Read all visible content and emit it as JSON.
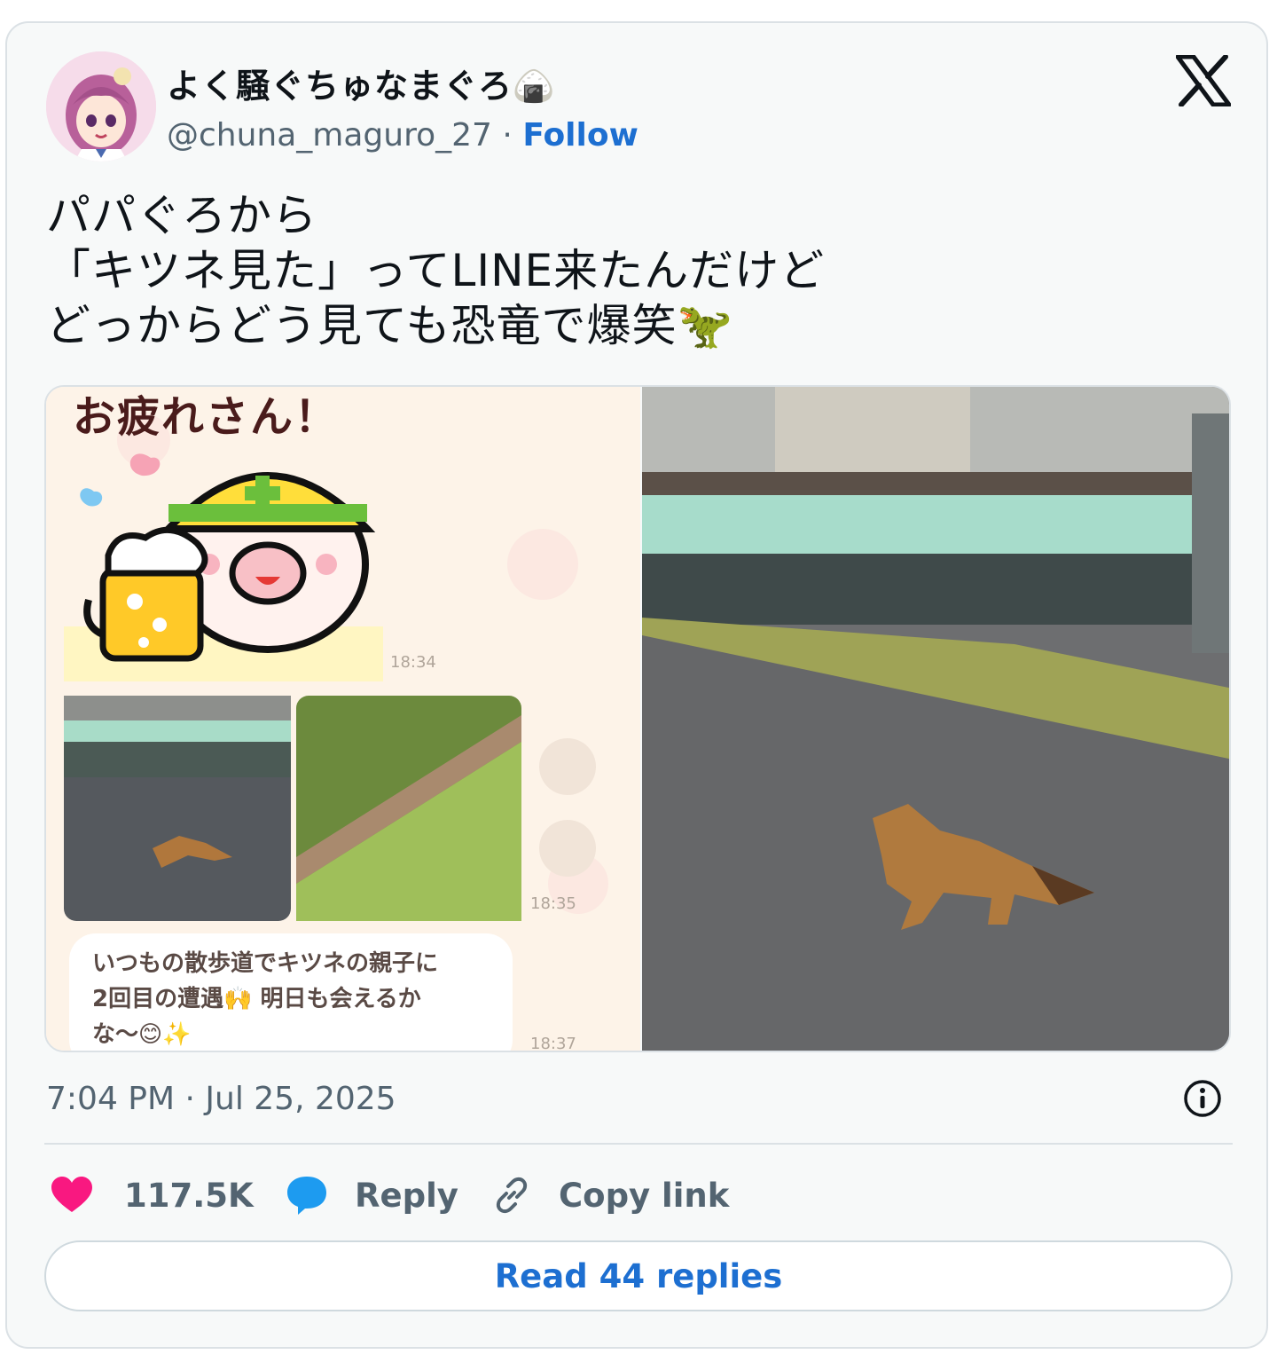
{
  "author": {
    "display_name": "よく騒ぐちゅなまぐろ🍙",
    "handle": "@chuna_maguro_27",
    "separator": "·",
    "follow_label": "Follow"
  },
  "tweet": {
    "text": "パパぐろから\n「キツネ見た」ってLINE来たんだけど\nどっからどう見ても恐竜で爆笑🦖"
  },
  "media": {
    "left_screenshot": {
      "header_text": "お疲れさん！",
      "time_1": "18:34",
      "time_2": "18:35",
      "message": "いつもの散歩道でキツネの親子に\n2回目の遭遇🙌 明日も会えるか\nな〜😊✨",
      "time_3": "18:37"
    }
  },
  "meta": {
    "timestamp": "7:04 PM · Jul 25, 2025"
  },
  "actions": {
    "likes": "117.5K",
    "reply_label": "Reply",
    "copy_label": "Copy link"
  },
  "read_replies_label": "Read 44 replies",
  "colors": {
    "link_blue": "#1d6fd1",
    "like_pink": "#f91880",
    "reply_blue": "#1d9bf0",
    "muted_gray": "#536471"
  },
  "icons": {
    "brand": "x-logo-icon",
    "info": "info-icon",
    "like": "heart-icon",
    "reply": "speech-bubble-icon",
    "copy": "link-icon"
  }
}
